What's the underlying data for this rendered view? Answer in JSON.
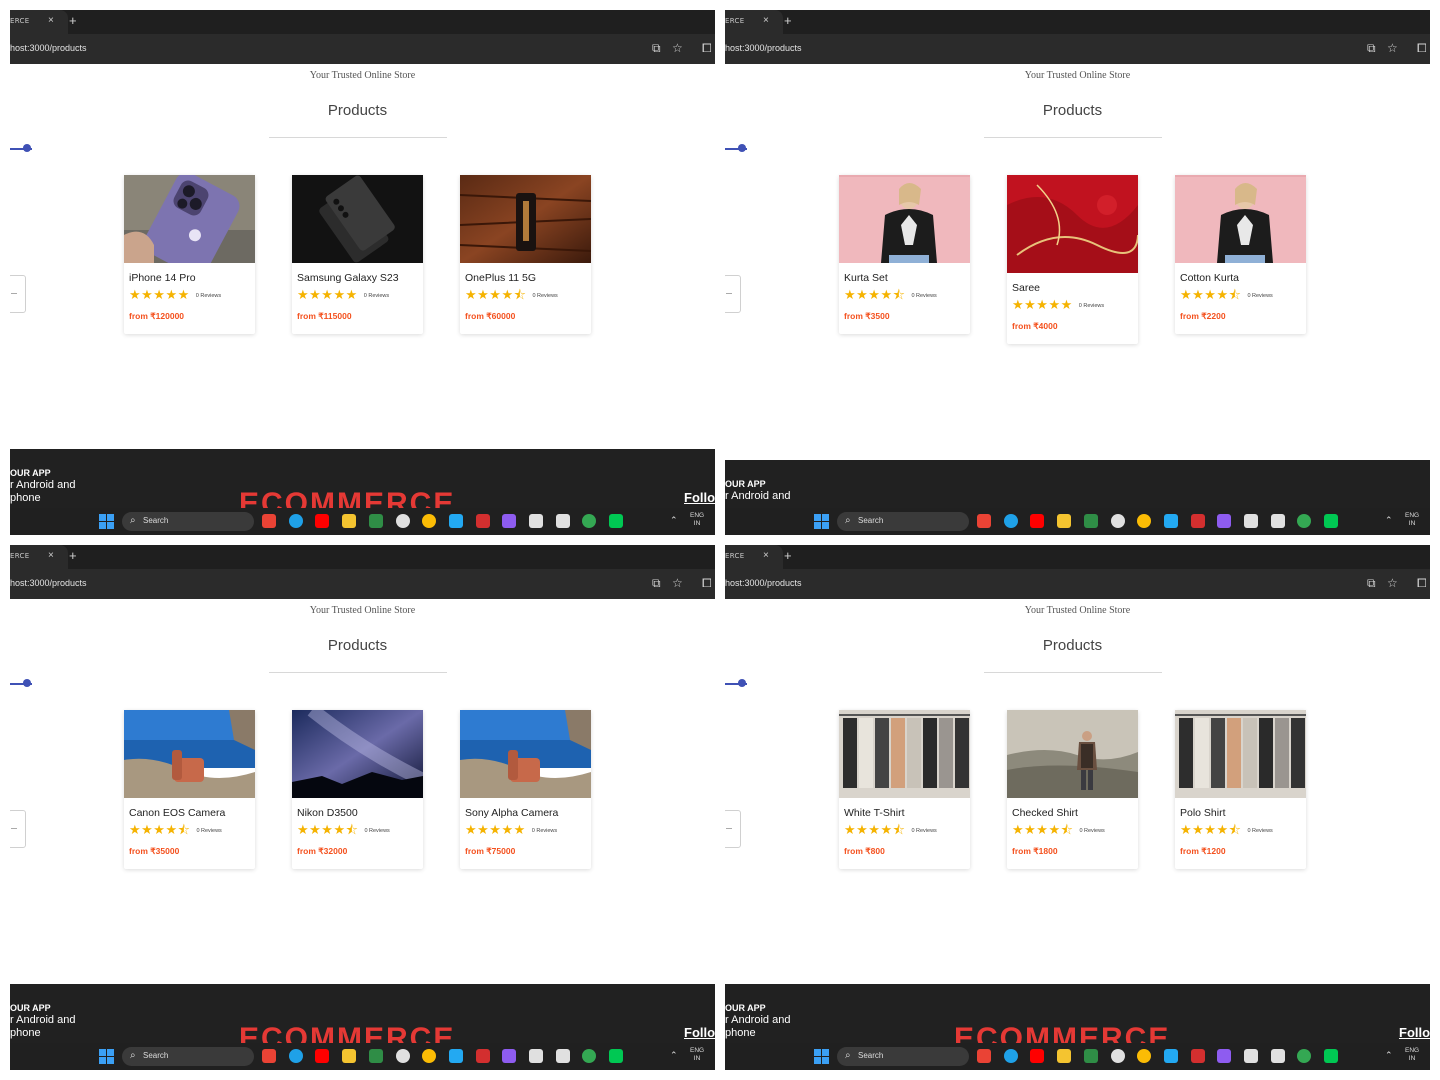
{
  "browser": {
    "tab_title": "ERCE",
    "tab_close": "×",
    "new_tab": "+",
    "url": "host:3000/products",
    "icons": [
      "cast-icon",
      "star-icon",
      "extensions-icon"
    ]
  },
  "page": {
    "tagline": "Your Trusted Online Store",
    "heading": "Products"
  },
  "screens": [
    {
      "products": [
        {
          "name": "iPhone 14 Pro",
          "rating": 5,
          "stars": "★★★★★",
          "reviews": "0 Reviews",
          "price": "from ₹120000",
          "image": "iphone-photo"
        },
        {
          "name": "Samsung Galaxy S23",
          "rating": 5,
          "stars": "★★★★★",
          "reviews": "0 Reviews",
          "price": "from ₹115000",
          "image": "samsung-photo"
        },
        {
          "name": "OnePlus 11 5G",
          "rating": 4.5,
          "stars": "★★★★⯪",
          "reviews": "0 Reviews",
          "price": "from ₹60000",
          "image": "oneplus-photo"
        }
      ],
      "footer": {
        "app": "OUR APP",
        "line1": "r Android and",
        "line2": "phone",
        "brand": "ECOMMERCE",
        "follow": "Follo"
      }
    },
    {
      "products": [
        {
          "name": "Kurta Set",
          "rating": 4.5,
          "stars": "★★★★⯪",
          "reviews": "0 Reviews",
          "price": "from ₹3500",
          "image": "tshirt-woman-photo"
        },
        {
          "name": "Saree",
          "rating": 5,
          "stars": "★★★★★",
          "reviews": "0 Reviews",
          "price": "from ₹4000",
          "image": "red-saree-photo"
        },
        {
          "name": "Cotton Kurta",
          "rating": 4.5,
          "stars": "★★★★⯪",
          "reviews": "0 Reviews",
          "price": "from ₹2200",
          "image": "tshirt-woman-photo"
        }
      ],
      "footer": {
        "app": "OUR APP",
        "line1": "r Android and",
        "line2": "",
        "brand": "",
        "follow": ""
      }
    },
    {
      "products": [
        {
          "name": "Canon EOS Camera",
          "rating": 4.5,
          "stars": "★★★★⯪",
          "reviews": "0 Reviews",
          "price": "from ₹35000",
          "image": "chair-sea-photo"
        },
        {
          "name": "Nikon D3500",
          "rating": 4.5,
          "stars": "★★★★⯪",
          "reviews": "0 Reviews",
          "price": "from ₹32000",
          "image": "milkyway-photo"
        },
        {
          "name": "Sony Alpha Camera",
          "rating": 5,
          "stars": "★★★★★",
          "reviews": "0 Reviews",
          "price": "from ₹75000",
          "image": "chair-sea-photo"
        }
      ],
      "footer": {
        "app": "OUR APP",
        "line1": "r Android and",
        "line2": "phone",
        "brand": "ECOMMERCE",
        "follow": "Follo"
      }
    },
    {
      "products": [
        {
          "name": "White T-Shirt",
          "rating": 4.5,
          "stars": "★★★★⯪",
          "reviews": "0 Reviews",
          "price": "from ₹800",
          "image": "clothes-rack-photo"
        },
        {
          "name": "Checked Shirt",
          "rating": 4.5,
          "stars": "★★★★⯪",
          "reviews": "0 Reviews",
          "price": "from ₹1800",
          "image": "man-hills-photo"
        },
        {
          "name": "Polo Shirt",
          "rating": 4.5,
          "stars": "★★★★⯪",
          "reviews": "0 Reviews",
          "price": "from ₹1200",
          "image": "clothes-rack-photo"
        }
      ],
      "footer": {
        "app": "OUR APP",
        "line1": "r Android and",
        "line2": "phone",
        "brand": "ECOMMERCE",
        "follow": "Follo"
      }
    }
  ],
  "taskbar": {
    "search_label": "Search",
    "lang_line1": "ENG",
    "lang_line2": "IN",
    "apps": [
      "gmail-icon",
      "edge-icon",
      "youtube-icon",
      "file-explorer-icon",
      "geeksforgeeks-icon",
      "chatgpt-icon",
      "chrome-icon",
      "vscode-icon",
      "tuf-icon",
      "copilot-icon",
      "ai-icon",
      "terminal-icon",
      "chrome-active-icon",
      "mongodb-icon"
    ],
    "app_colors": [
      "#ea4335",
      "#1fa1e8",
      "#ff0000",
      "#f4c430",
      "#2f8d46",
      "#e0e0e0",
      "#fbbc05",
      "#23a9f2",
      "#d32f2f",
      "#8e5cf0",
      "#e0e0e0",
      "#e0e0e0",
      "#34a853",
      "#00c853"
    ]
  },
  "colors": {
    "accent": "#3f51b5",
    "price": "#f4511e",
    "star": "#f5b301",
    "brand": "#e53935",
    "footer_bg": "#212121"
  }
}
